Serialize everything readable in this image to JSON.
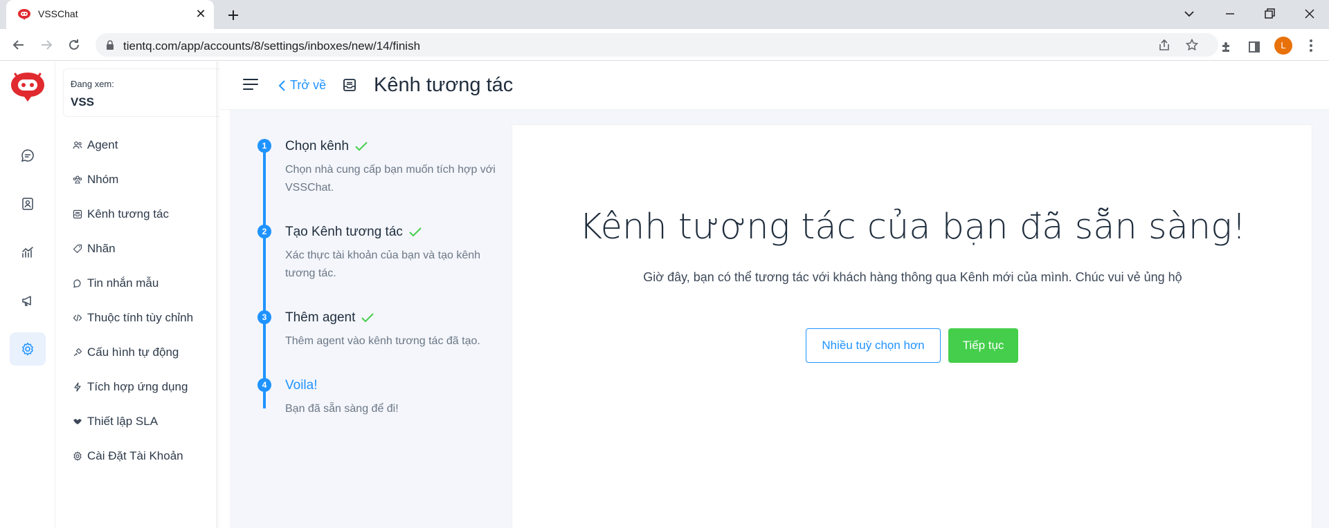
{
  "browser": {
    "tab_title": "VSSChat",
    "tab_close": "✕",
    "url": "tientq.com/app/accounts/8/settings/inboxes/new/14/finish",
    "profile_initial": "L"
  },
  "rail": {
    "items": [
      {
        "icon": "chat-bubble-icon",
        "active": false
      },
      {
        "icon": "contacts-icon",
        "active": false
      },
      {
        "icon": "reports-icon",
        "active": false
      },
      {
        "icon": "campaign-megaphone-icon",
        "active": false
      },
      {
        "icon": "settings-gear-icon",
        "active": true
      }
    ]
  },
  "viewing": {
    "label": "Đang xem:",
    "value": "VSS"
  },
  "settings_nav": {
    "items": [
      {
        "label": "Agent",
        "icon": "people-icon"
      },
      {
        "label": "Nhóm",
        "icon": "team-icon"
      },
      {
        "label": "Kênh tương tác",
        "icon": "inbox-icon"
      },
      {
        "label": "Nhãn",
        "icon": "tag-icon"
      },
      {
        "label": "Tin nhắn mẫu",
        "icon": "chat-template-icon"
      },
      {
        "label": "Thuộc tính tùy chỉnh",
        "icon": "code-icon"
      },
      {
        "label": "Cấu hình tự động",
        "icon": "automation-icon"
      },
      {
        "label": "Tích hợp ứng dụng",
        "icon": "flash-icon"
      },
      {
        "label": "Thiết lập SLA",
        "icon": "handshake-icon"
      },
      {
        "label": "Cài Đặt Tài Khoản",
        "icon": "gear-icon"
      }
    ]
  },
  "header": {
    "back_label": "Trở về",
    "title": "Kênh tương tác"
  },
  "steps": [
    {
      "number": "1",
      "title": "Chọn kênh",
      "done": true,
      "description": "Chọn nhà cung cấp bạn muốn tích hợp với VSSChat."
    },
    {
      "number": "2",
      "title": "Tạo Kênh tương tác",
      "done": true,
      "description": "Xác thực tài khoản của bạn và tạo kênh tương tác."
    },
    {
      "number": "3",
      "title": "Thêm agent",
      "done": true,
      "description": "Thêm agent vào kênh tương tác đã tạo."
    },
    {
      "number": "4",
      "title": "Voila!",
      "done": false,
      "description": "Bạn đã sẵn sàng để đi!"
    }
  ],
  "finish": {
    "title": "Kênh tương tác của bạn đã sẵn sàng!",
    "subtitle": "Giờ đây, bạn có thể tương tác với khách hàng thông qua Kênh mới của mình. Chúc vui vẻ ủng hộ",
    "more_options_label": "Nhiều tuỳ chọn hơn",
    "continue_label": "Tiếp tục"
  },
  "colors": {
    "accent": "#1f93ff",
    "success": "#44ce4b",
    "brand_red": "#e02a2f"
  }
}
